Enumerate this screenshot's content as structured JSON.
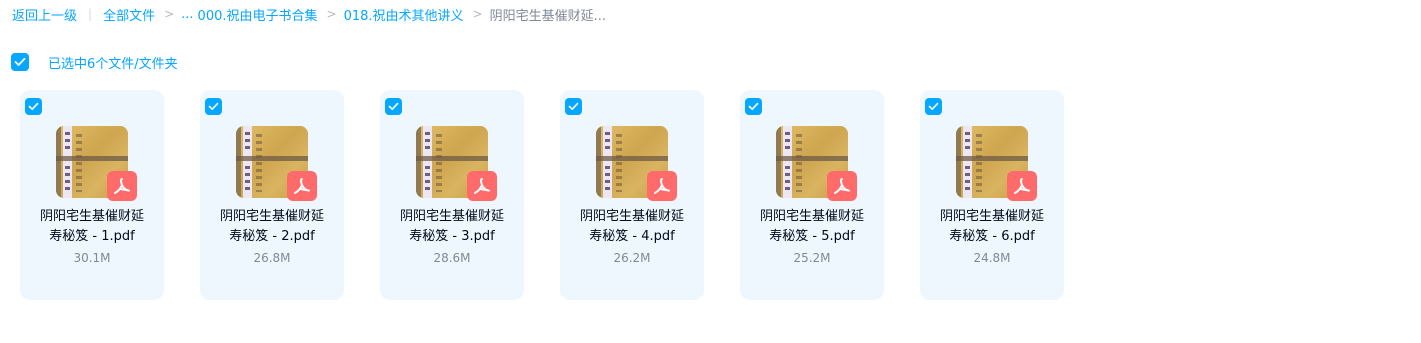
{
  "breadcrumb": {
    "back": "返回上一级",
    "all_files": "全部文件",
    "ellipsis": "...",
    "folder1": "000.祝由电子书合集",
    "folder2": "018.祝由术其他讲义",
    "current": "阴阳宅生基催财延..."
  },
  "selection": {
    "label": "已选中6个文件/文件夹",
    "checked": true
  },
  "colors": {
    "accent": "#06a7ff",
    "card_bg": "#eef7fe",
    "pdf_badge": "#ff6a6a"
  },
  "files": [
    {
      "name_line1": "阴阳宅生基催财延",
      "name_line2": "寿秘笈 - 1.pdf",
      "size": "30.1M",
      "icon": "pdf-icon",
      "checked": true
    },
    {
      "name_line1": "阴阳宅生基催财延",
      "name_line2": "寿秘笈 - 2.pdf",
      "size": "26.8M",
      "icon": "pdf-icon",
      "checked": true
    },
    {
      "name_line1": "阴阳宅生基催财延",
      "name_line2": "寿秘笈 - 3.pdf",
      "size": "28.6M",
      "icon": "pdf-icon",
      "checked": true
    },
    {
      "name_line1": "阴阳宅生基催财延",
      "name_line2": "寿秘笈 - 4.pdf",
      "size": "26.2M",
      "icon": "pdf-icon",
      "checked": true
    },
    {
      "name_line1": "阴阳宅生基催财延",
      "name_line2": "寿秘笈 - 5.pdf",
      "size": "25.2M",
      "icon": "pdf-icon",
      "checked": true
    },
    {
      "name_line1": "阴阳宅生基催财延",
      "name_line2": "寿秘笈 - 6.pdf",
      "size": "24.8M",
      "icon": "pdf-icon",
      "checked": true
    }
  ]
}
